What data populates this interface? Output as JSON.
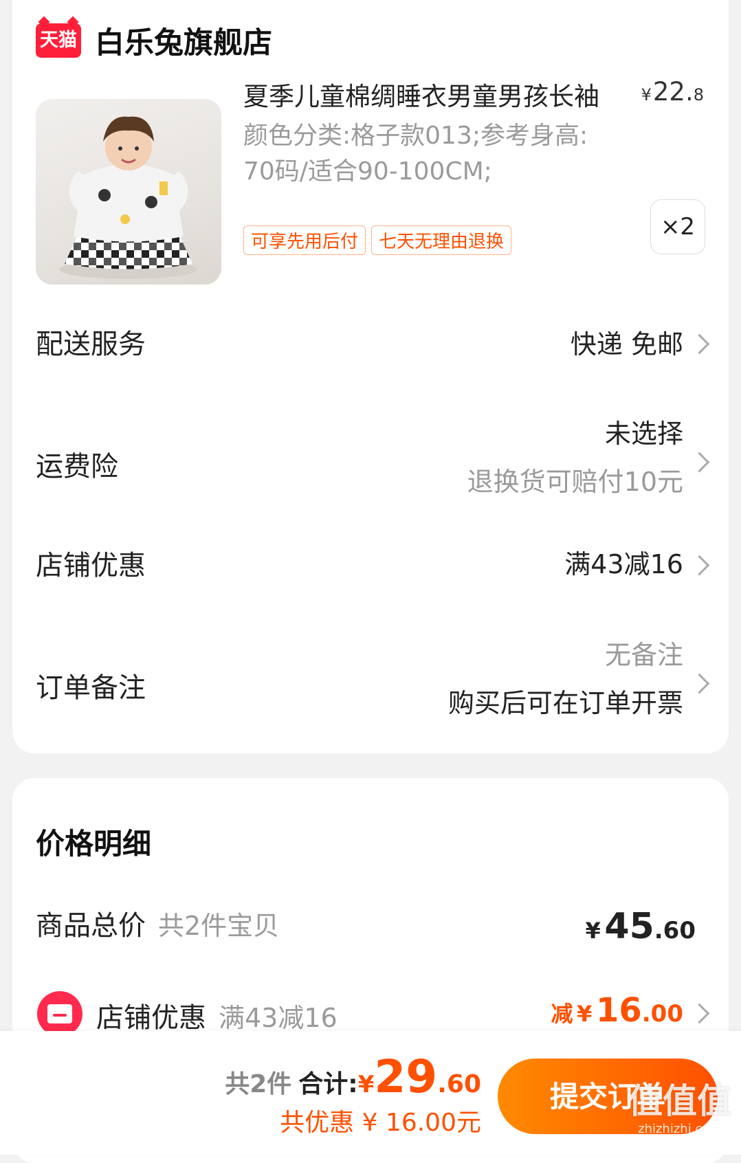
{
  "store": {
    "badge": "天猫",
    "name": "白乐兔旗舰店"
  },
  "product": {
    "title": "夏季儿童棉绸睡衣男童男孩长袖",
    "price_symbol": "¥",
    "price_int": "22.",
    "price_dec": "8",
    "sku_line1": "颜色分类:格子款013;参考身高:",
    "sku_line2": "70码/适合90-100CM;",
    "tags": [
      "可享先用后付",
      "七天无理由退换"
    ],
    "quantity": "×2"
  },
  "rows": {
    "delivery": {
      "label": "配送服务",
      "value": "快递 免邮"
    },
    "insurance": {
      "label": "运费险",
      "value": "未选择",
      "sub": "退换货可赔付10元"
    },
    "store_discount": {
      "label": "店铺优惠",
      "value": "满43减16"
    },
    "note": {
      "label": "订单备注",
      "value": "无备注",
      "sub": "购买后可在订单开票"
    }
  },
  "price_details": {
    "title": "价格明细",
    "goods_total_label": "商品总价",
    "goods_total_sub": "共2件宝贝",
    "goods_total_symbol": "¥",
    "goods_total_int": "45",
    "goods_total_dec": ".60",
    "shop_discount_label": "店铺优惠",
    "shop_discount_sub": "满43减16",
    "shop_discount_prefix": "减",
    "shop_discount_symbol": "¥",
    "shop_discount_int": "16",
    "shop_discount_dec": ".00"
  },
  "bottom_bar": {
    "count": "共2件",
    "total_label": "合计:",
    "total_symbol": "¥",
    "total_int": "29",
    "total_dec": ".60",
    "saved": "共优惠 ¥ 16.00元",
    "submit": "提交订单"
  },
  "watermark": {
    "big": "值值值",
    "small": "zhizhizhi.com"
  },
  "colors": {
    "accent": "#ff5000",
    "tmall_red": "#ff1f3a"
  }
}
